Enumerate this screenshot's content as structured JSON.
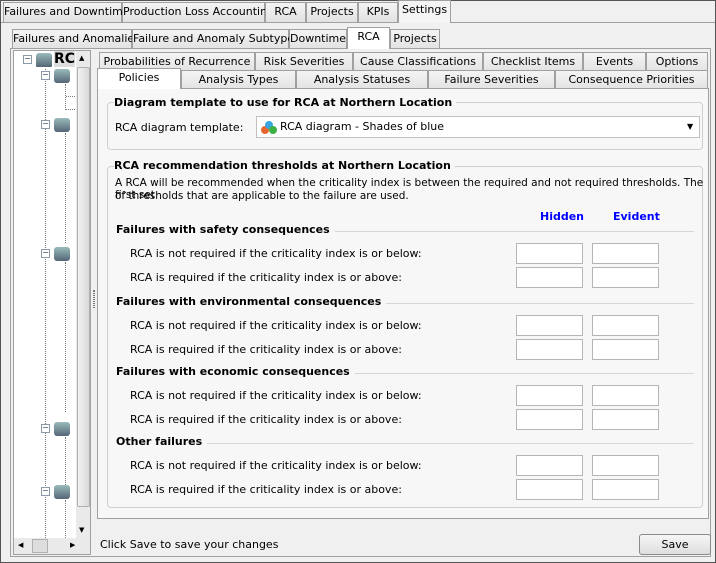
{
  "main_tabs": [
    "Failures and Downtime",
    "Production Loss Accounting",
    "RCA",
    "Projects",
    "KPIs",
    "Settings"
  ],
  "sub_tabs": [
    "Failures and Anomalies",
    "Failure and Anomaly Subtypes",
    "Downtime",
    "RCA",
    "Projects"
  ],
  "tree": {
    "root_label": "RC"
  },
  "rca_tabs_row1": [
    "Probabilities of Recurrence",
    "Risk Severities",
    "Cause Classifications",
    "Checklist Items",
    "Events",
    "Options"
  ],
  "rca_tabs_row2": [
    "Policies",
    "Analysis Types",
    "Analysis Statuses",
    "Failure Severities",
    "Consequence Priorities"
  ],
  "diagram": {
    "title": "Diagram template to use for RCA at Northern Location",
    "label": "RCA diagram template:",
    "value": "RCA diagram - Shades of blue"
  },
  "thresholds": {
    "title": "RCA recommendation thresholds at Northern Location",
    "desc1": "A RCA will be recommended when the criticality index is between the required and not required thresholds.  The first set",
    "desc2": "of thresholds that are applicable to the failure are used.",
    "col_hidden": "Hidden",
    "col_evident": "Evident",
    "sections": [
      {
        "title": "Failures with safety consequences",
        "not_required": "RCA is not required if the criticality index is or below:",
        "required": "RCA is required if the criticality index is or above:"
      },
      {
        "title": "Failures with environmental consequences",
        "not_required": "RCA is not required if the criticality index is or below:",
        "required": "RCA is required if the criticality index is or above:"
      },
      {
        "title": "Failures with economic consequences",
        "not_required": "RCA is not required if the criticality index is or below:",
        "required": "RCA is required if the criticality index is or above:"
      },
      {
        "title": "Other failures",
        "not_required": "RCA is not required if the criticality index is or below:",
        "required": "RCA is required if the criticality index is or above:"
      }
    ]
  },
  "status": "Click Save to save your changes",
  "save_label": "Save",
  "colors": {
    "header_blue": "#0000ff"
  }
}
